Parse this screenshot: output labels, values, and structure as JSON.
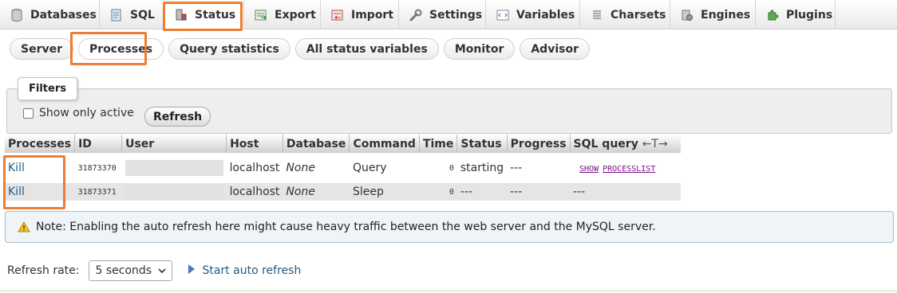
{
  "top_tabs": [
    {
      "label": "Databases",
      "icon": "database-icon"
    },
    {
      "label": "SQL",
      "icon": "sql-icon"
    },
    {
      "label": "Status",
      "icon": "status-icon",
      "active": true
    },
    {
      "label": "Export",
      "icon": "export-icon"
    },
    {
      "label": "Import",
      "icon": "import-icon"
    },
    {
      "label": "Settings",
      "icon": "wrench-icon"
    },
    {
      "label": "Variables",
      "icon": "variables-icon"
    },
    {
      "label": "Charsets",
      "icon": "charsets-icon"
    },
    {
      "label": "Engines",
      "icon": "engines-icon"
    },
    {
      "label": "Plugins",
      "icon": "puzzle-icon"
    }
  ],
  "sub_tabs": [
    {
      "label": "Server"
    },
    {
      "label": "Processes",
      "active": true
    },
    {
      "label": "Query statistics"
    },
    {
      "label": "All status variables"
    },
    {
      "label": "Monitor"
    },
    {
      "label": "Advisor"
    }
  ],
  "filters": {
    "legend": "Filters",
    "show_only_active_label": "Show only active",
    "show_only_active_checked": false,
    "refresh_button": "Refresh"
  },
  "table": {
    "columns": [
      "Processes",
      "ID",
      "User",
      "Host",
      "Database",
      "Command",
      "Time",
      "Status",
      "Progress",
      "SQL query"
    ],
    "sql_query_toggle": "←T→",
    "rows": [
      {
        "action": "Kill",
        "id": "31873370",
        "host": "localhost",
        "database": "None",
        "command": "Query",
        "time": "0",
        "status": "starting",
        "progress": "---",
        "sql_query": [
          "SHOW",
          "PROCESSLIST"
        ]
      },
      {
        "action": "Kill",
        "id": "31873371",
        "host": "localhost",
        "database": "None",
        "command": "Sleep",
        "time": "0",
        "status": "---",
        "progress": "---",
        "sql_query_text": "---"
      }
    ]
  },
  "notice": {
    "text": "Note: Enabling the auto refresh here might cause heavy traffic between the web server and the MySQL server.",
    "icon": "warning-icon"
  },
  "refresh": {
    "label": "Refresh rate:",
    "selected": "5 seconds",
    "auto_refresh": "Start auto refresh"
  },
  "colors": {
    "highlight": "#ed7d31",
    "link": "#235a81",
    "sql_keyword": "#7a0f8a",
    "notice_bg": "#eef4f7"
  }
}
